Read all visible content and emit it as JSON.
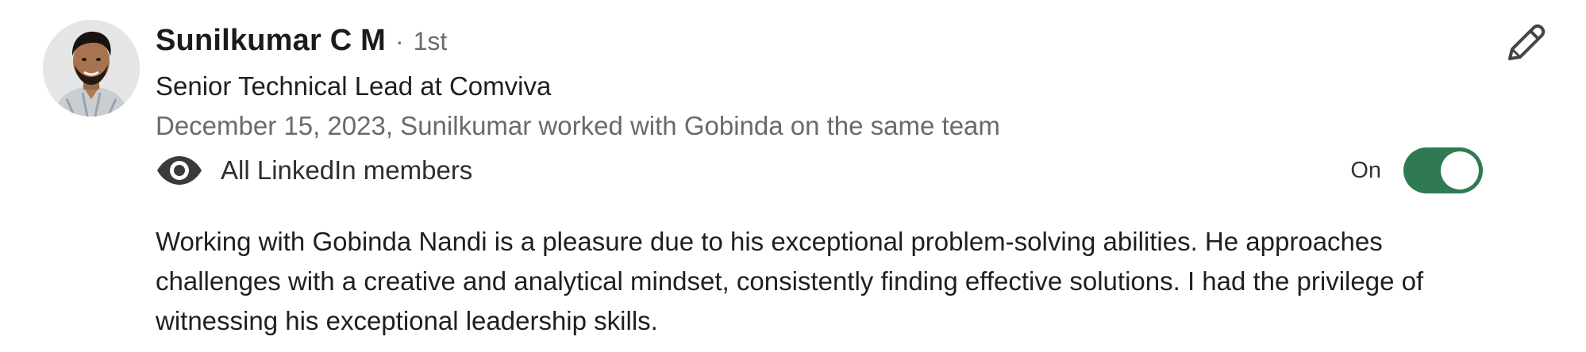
{
  "recommender": {
    "name": "Sunilkumar C M",
    "degree_separator": "·",
    "degree": "1st",
    "headline": "Senior Technical Lead at Comviva",
    "relation": "December 15, 2023, Sunilkumar worked with Gobinda on the same team",
    "avatar_icon": "profile-photo"
  },
  "visibility": {
    "icon": "eye-icon",
    "label": "All LinkedIn members",
    "toggle_label": "On",
    "toggle_on": true,
    "toggle_color": "#2f7a52"
  },
  "actions": {
    "edit_icon": "pencil-icon"
  },
  "recommendation": {
    "text": "Working with Gobinda Nandi is a pleasure due to his exceptional problem-solving abilities. He approaches challenges with a creative and analytical mindset, consistently finding effective solutions. I had the privilege of witnessing his exceptional leadership skills."
  }
}
